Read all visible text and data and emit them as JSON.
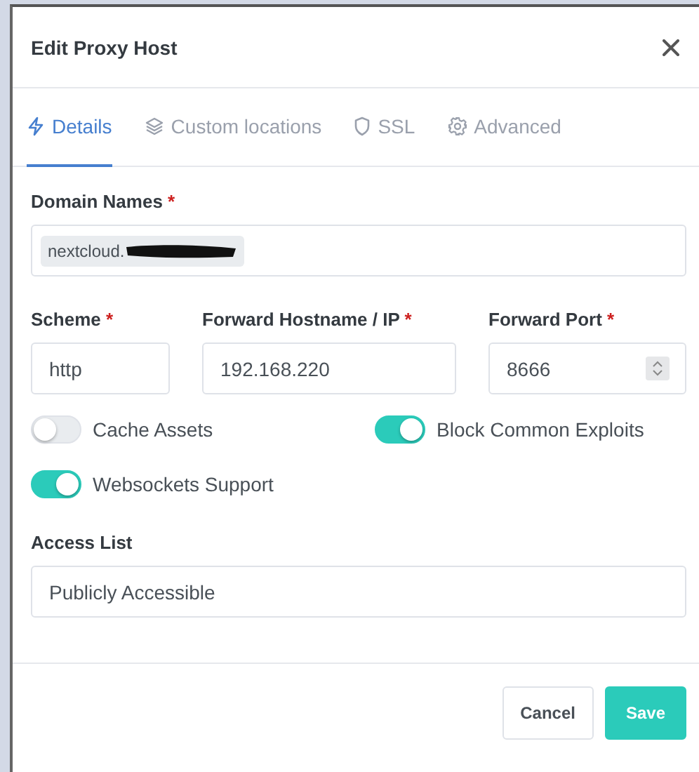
{
  "dialog": {
    "title": "Edit Proxy Host"
  },
  "tabs": [
    {
      "label": "Details",
      "selected": true
    },
    {
      "label": "Custom locations",
      "selected": false
    },
    {
      "label": "SSL",
      "selected": false
    },
    {
      "label": "Advanced",
      "selected": false
    }
  ],
  "domain_names": {
    "label": "Domain Names",
    "required_mark": "*",
    "tags": [
      {
        "text": "nextcloud.",
        "redacted": true
      }
    ]
  },
  "fields": [
    {
      "label": "Scheme",
      "required_mark": "*",
      "value": "http",
      "kind": "text"
    },
    {
      "label": "Forward Hostname / IP",
      "required_mark": "*",
      "value": "192.168.220",
      "kind": "text"
    },
    {
      "label": "Forward Port",
      "required_mark": "*",
      "value": "8666",
      "kind": "number"
    }
  ],
  "toggles": [
    {
      "label": "Cache Assets",
      "on": false
    },
    {
      "label": "Block Common Exploits",
      "on": true
    },
    {
      "label": "Websockets Support",
      "on": true
    }
  ],
  "access_list": {
    "label": "Access List",
    "value": "Publicly Accessible"
  },
  "buttons": [
    {
      "label": "Cancel",
      "kind": "secondary"
    },
    {
      "label": "Save",
      "kind": "primary"
    }
  ]
}
